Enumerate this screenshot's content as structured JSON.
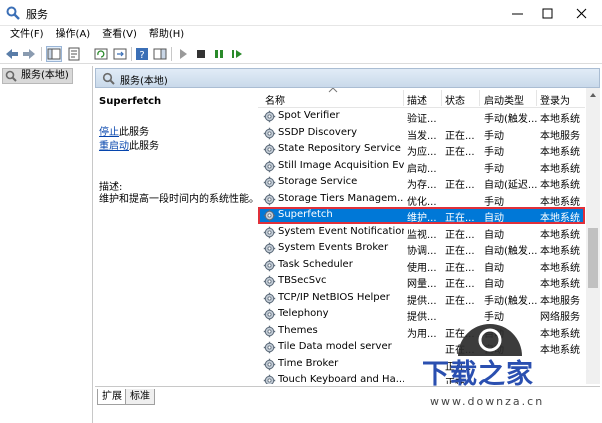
{
  "window": {
    "title": "服务",
    "controls": {
      "minimize_icon": "minimize-icon",
      "maximize_icon": "maximize-icon",
      "close_icon": "close-icon"
    }
  },
  "menu": [
    "文件(F)",
    "操作(A)",
    "查看(V)",
    "帮助(H)"
  ],
  "toolbar": {
    "icons": [
      "back-arrow-icon",
      "forward-arrow-icon",
      "console-tree-icon",
      "properties-icon",
      "refresh-icon",
      "export-icon",
      "help-icon",
      "show-hide-icon",
      "play-icon",
      "stop-icon",
      "pause-icon",
      "resume-icon"
    ]
  },
  "tree": {
    "root_label": "服务(本地)"
  },
  "pane_header": {
    "title": "服务(本地)"
  },
  "details": {
    "service_name": "Superfetch",
    "stop_link": "停止",
    "stop_suffix": "此服务",
    "restart_link": "重启动",
    "restart_suffix": "此服务",
    "desc_label": "描述:",
    "desc_text": "维护和提高一段时间内的系统性能。"
  },
  "list": {
    "columns": [
      "名称",
      "描述",
      "状态",
      "启动类型",
      "登录为"
    ],
    "rows": [
      {
        "name": "Spot Verifier",
        "desc": "验证...",
        "status": "",
        "start": "手动(触发...",
        "logon": "本地系统"
      },
      {
        "name": "SSDP Discovery",
        "desc": "当发...",
        "status": "正在...",
        "start": "手动",
        "logon": "本地服务"
      },
      {
        "name": "State Repository Service",
        "desc": "为应...",
        "status": "正在...",
        "start": "手动",
        "logon": "本地系统"
      },
      {
        "name": "Still Image Acquisition Ev...",
        "desc": "启动...",
        "status": "",
        "start": "手动",
        "logon": "本地系统"
      },
      {
        "name": "Storage Service",
        "desc": "为存...",
        "status": "正在...",
        "start": "自动(延迟...",
        "logon": "本地系统"
      },
      {
        "name": "Storage Tiers Managem...",
        "desc": "优化...",
        "status": "",
        "start": "手动",
        "logon": "本地系统"
      },
      {
        "name": "Superfetch",
        "desc": "维护...",
        "status": "正在...",
        "start": "自动",
        "logon": "本地系统"
      },
      {
        "name": "System Event Notification...",
        "desc": "监视...",
        "status": "正在...",
        "start": "自动",
        "logon": "本地系统"
      },
      {
        "name": "System Events Broker",
        "desc": "协调...",
        "status": "正在...",
        "start": "自动(触发...",
        "logon": "本地系统"
      },
      {
        "name": "Task Scheduler",
        "desc": "使用...",
        "status": "正在...",
        "start": "自动",
        "logon": "本地系统"
      },
      {
        "name": "TBSecSvc",
        "desc": "网量...",
        "status": "正在...",
        "start": "自动",
        "logon": "本地系统"
      },
      {
        "name": "TCP/IP NetBIOS Helper",
        "desc": "提供...",
        "status": "正在...",
        "start": "手动(触发...",
        "logon": "本地服务"
      },
      {
        "name": "Telephony",
        "desc": "提供...",
        "status": "",
        "start": "手动",
        "logon": "网络服务"
      },
      {
        "name": "Themes",
        "desc": "为用...",
        "status": "正在...",
        "start": "自动",
        "logon": "本地系统"
      },
      {
        "name": "Tile Data model server",
        "desc": "",
        "status": "正在...",
        "start": "自动",
        "logon": "本地系统"
      },
      {
        "name": "Time Broker",
        "desc": "",
        "status": "正在...",
        "start": "",
        "logon": ""
      },
      {
        "name": "Touch Keyboard and Ha...",
        "desc": "",
        "status": "正在...",
        "start": "",
        "logon": ""
      }
    ],
    "selected_row": "Superfetch"
  },
  "tabs": [
    "扩展",
    "标准"
  ],
  "watermark": {
    "brand": "下载之家",
    "url": "www.downza.cn"
  },
  "colors": {
    "selection": "#0078d7",
    "highlight_border": "#e0303a",
    "link": "#0645ad",
    "watermark_blue": "#2a4fb0"
  }
}
